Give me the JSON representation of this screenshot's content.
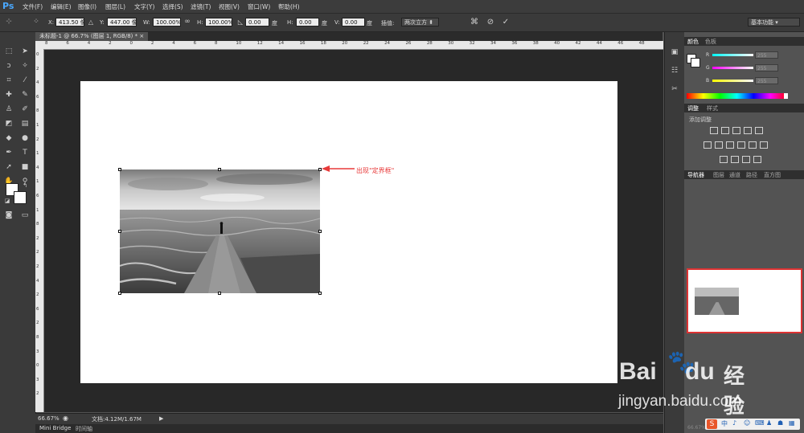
{
  "app": {
    "logo": "Ps"
  },
  "menu": [
    "文件(F)",
    "编辑(E)",
    "图像(I)",
    "图层(L)",
    "文字(Y)",
    "选择(S)",
    "滤镜(T)",
    "视图(V)",
    "窗口(W)",
    "帮助(H)"
  ],
  "options": {
    "x_label": "X:",
    "x_value": "413.50 像",
    "y_label": "Y:",
    "y_value": "447.00 像",
    "w_label": "W:",
    "w_value": "100.00%",
    "h_label": "H:",
    "h_value": "100.00%",
    "angle_value": "0.00",
    "angle_unit": "度",
    "hskew_label": "H:",
    "hskew_value": "0.00",
    "hskew_unit": "度",
    "vskew_label": "V:",
    "vskew_value": "0.00",
    "vskew_unit": "度",
    "interp_label": "插值:",
    "interp_value": "两次立方",
    "workspace": "基本功能"
  },
  "document_tab": {
    "title": "未标题-1 @ 66.7% (图层 1, RGB/8) *",
    "close": "×"
  },
  "ruler_h": [
    "8",
    "6",
    "4",
    "2",
    "0",
    "2",
    "4",
    "6",
    "8",
    "10",
    "12",
    "14",
    "16",
    "18",
    "20",
    "22",
    "24",
    "26",
    "28",
    "30",
    "32",
    "34",
    "36",
    "38",
    "40",
    "42",
    "44",
    "46",
    "48"
  ],
  "ruler_v": [
    "0",
    "2",
    "4",
    "6",
    "8",
    "1",
    "2",
    "1",
    "4",
    "1",
    "6",
    "1",
    "8",
    "2",
    "2",
    "2",
    "4",
    "2",
    "6",
    "2",
    "8",
    "3",
    "0",
    "3",
    "2"
  ],
  "annotation": "出现\"定界框\"",
  "status": {
    "zoom": "66.67%",
    "doc": "文档:4.12M/1.67M"
  },
  "bottom_tabs": [
    "Mini Bridge",
    "时间轴"
  ],
  "color_panel": {
    "tabs": [
      "颜色",
      "色板"
    ],
    "r_label": "R",
    "g_label": "G",
    "b_label": "B",
    "r_value": "255",
    "g_value": "255",
    "b_value": "255"
  },
  "adjust_panel": {
    "tabs": [
      "调整",
      "样式"
    ],
    "title": "添加调整"
  },
  "nav_panel": {
    "tabs": [
      "导航器",
      "图层",
      "通道",
      "路径",
      "直方图"
    ],
    "zoom": "66.67%"
  },
  "watermark": {
    "brand": "Bai",
    "brand2": "du",
    "jingyan": "经验",
    "url": "jingyan.baidu.com"
  },
  "ime": [
    "中",
    "♪",
    "☺",
    "⌨",
    "♟",
    "☗",
    "▦"
  ],
  "colors": {
    "accent": "#e83a3a",
    "chrome": "#3a3a3a",
    "canvas": "#282828"
  }
}
